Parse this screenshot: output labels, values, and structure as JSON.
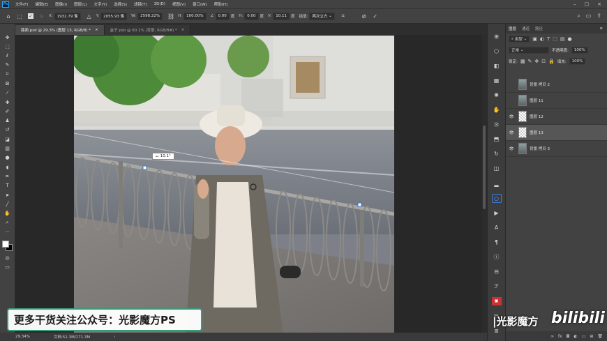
{
  "menu": {
    "logo": "Ps",
    "items": [
      "文件(F)",
      "编辑(E)",
      "图像(I)",
      "图层(L)",
      "文字(Y)",
      "选择(S)",
      "滤镜(T)",
      "3D(D)",
      "视图(V)",
      "窗口(W)",
      "帮助(H)"
    ]
  },
  "options": {
    "x_label": "X:",
    "x_value": "1932.79 像",
    "y_label": "Y:",
    "y_value": "2055.93 像",
    "w_label": "W:",
    "w_value": "2598.22%",
    "h_label": "H:",
    "h_value": "100.00%",
    "angle_value": "0.00",
    "angle_unit": "度",
    "hskew_label": "H:",
    "hskew_value": "0.00",
    "hskew_unit": "度",
    "vskew_label": "V:",
    "vskew_value": "10.11",
    "vskew_unit": "度",
    "interp_label": "插值:",
    "interp_value": "两次立方"
  },
  "tabs": [
    {
      "label": "路面.psd @ 29.3% (图层 13, RGB/8) *",
      "close": "×"
    },
    {
      "label": "盒子.psb @ 60.1% (背景, RGB/8#) *",
      "close": "×"
    }
  ],
  "canvas": {
    "angle_tooltip": "⦣: 10.1°"
  },
  "status": {
    "zoom": "29.34%",
    "doc": "文档:51.3M/171.3M",
    "arrow": "›"
  },
  "layers_panel": {
    "tabs": [
      "图层",
      "通道",
      "路径"
    ],
    "menu_icon": "≡",
    "filter_kind": "类型",
    "blend_mode": "正常",
    "opacity_label": "不透明度:",
    "opacity_value": "100%",
    "lock_label": "锁定:",
    "fill_label": "填充:",
    "fill_value": "100%",
    "layers": [
      {
        "name": "背景 拷贝 2",
        "visible": false,
        "thumb": "photo",
        "selected": false
      },
      {
        "name": "图层 11",
        "visible": false,
        "thumb": "photo",
        "selected": false
      },
      {
        "name": "图层 12",
        "visible": true,
        "thumb": "checker",
        "selected": false
      },
      {
        "name": "图层 13",
        "visible": true,
        "thumb": "checker",
        "selected": true
      },
      {
        "name": "背景 拷贝 3",
        "visible": true,
        "thumb": "photo",
        "selected": false
      }
    ],
    "bottom_icons": [
      "∞",
      "fx",
      "◘",
      "◐",
      "▭",
      "⊞",
      "🗑"
    ]
  },
  "overlays": {
    "watermark": "更多干货关注公众号：光影魔方PS",
    "brand": "|光影魔方",
    "bilibili": "bilibili"
  },
  "colors": {
    "accent": "#31a8ff",
    "watermark_border": "#3a9a7a",
    "foreground": "#ffffff",
    "background": "#000000"
  }
}
